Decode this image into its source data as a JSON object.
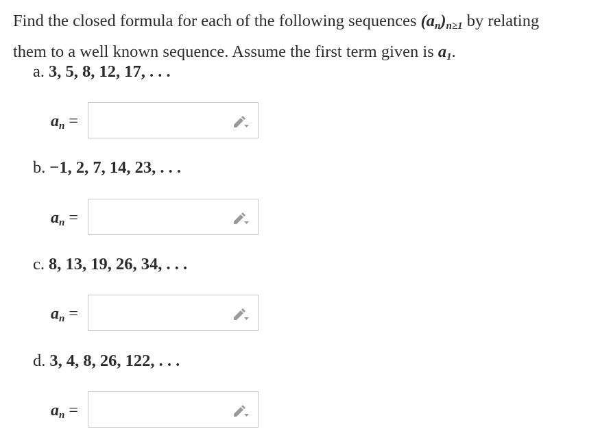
{
  "prompt": {
    "line1_pre": "Find the closed formula for each of the following sequences ",
    "line1_math": "(a",
    "line1_math_sub_n": "n",
    "line1_math_post": ")",
    "line1_math_sub_range": "n≥1",
    "line1_post": " by relating",
    "line2_pre": "them to a well known sequence. Assume the first term given is ",
    "line2_math": "a",
    "line2_math_sub": "1",
    "line2_post": "."
  },
  "parts": [
    {
      "letter": "a.",
      "sequence": "3, 5, 8, 12, 17, . . .",
      "answer_var": "a",
      "answer_sub": "n",
      "answer_eq": "=",
      "input_value": ""
    },
    {
      "letter": "b.",
      "sequence": "−1, 2, 7, 14, 23, . . .",
      "answer_var": "a",
      "answer_sub": "n",
      "answer_eq": "=",
      "input_value": ""
    },
    {
      "letter": "c.",
      "sequence": "8, 13, 19, 26, 34, . . .",
      "answer_var": "a",
      "answer_sub": "n",
      "answer_eq": "=",
      "input_value": ""
    },
    {
      "letter": "d.",
      "sequence": "3, 4, 8, 26, 122, . . .",
      "answer_var": "a",
      "answer_sub": "n",
      "answer_eq": "=",
      "input_value": ""
    }
  ],
  "icons": {
    "editor": "pencil-dropdown-icon"
  },
  "colors": {
    "text": "#2c2c2c",
    "border": "#c8c8c8",
    "icon": "#9a9a9a"
  }
}
